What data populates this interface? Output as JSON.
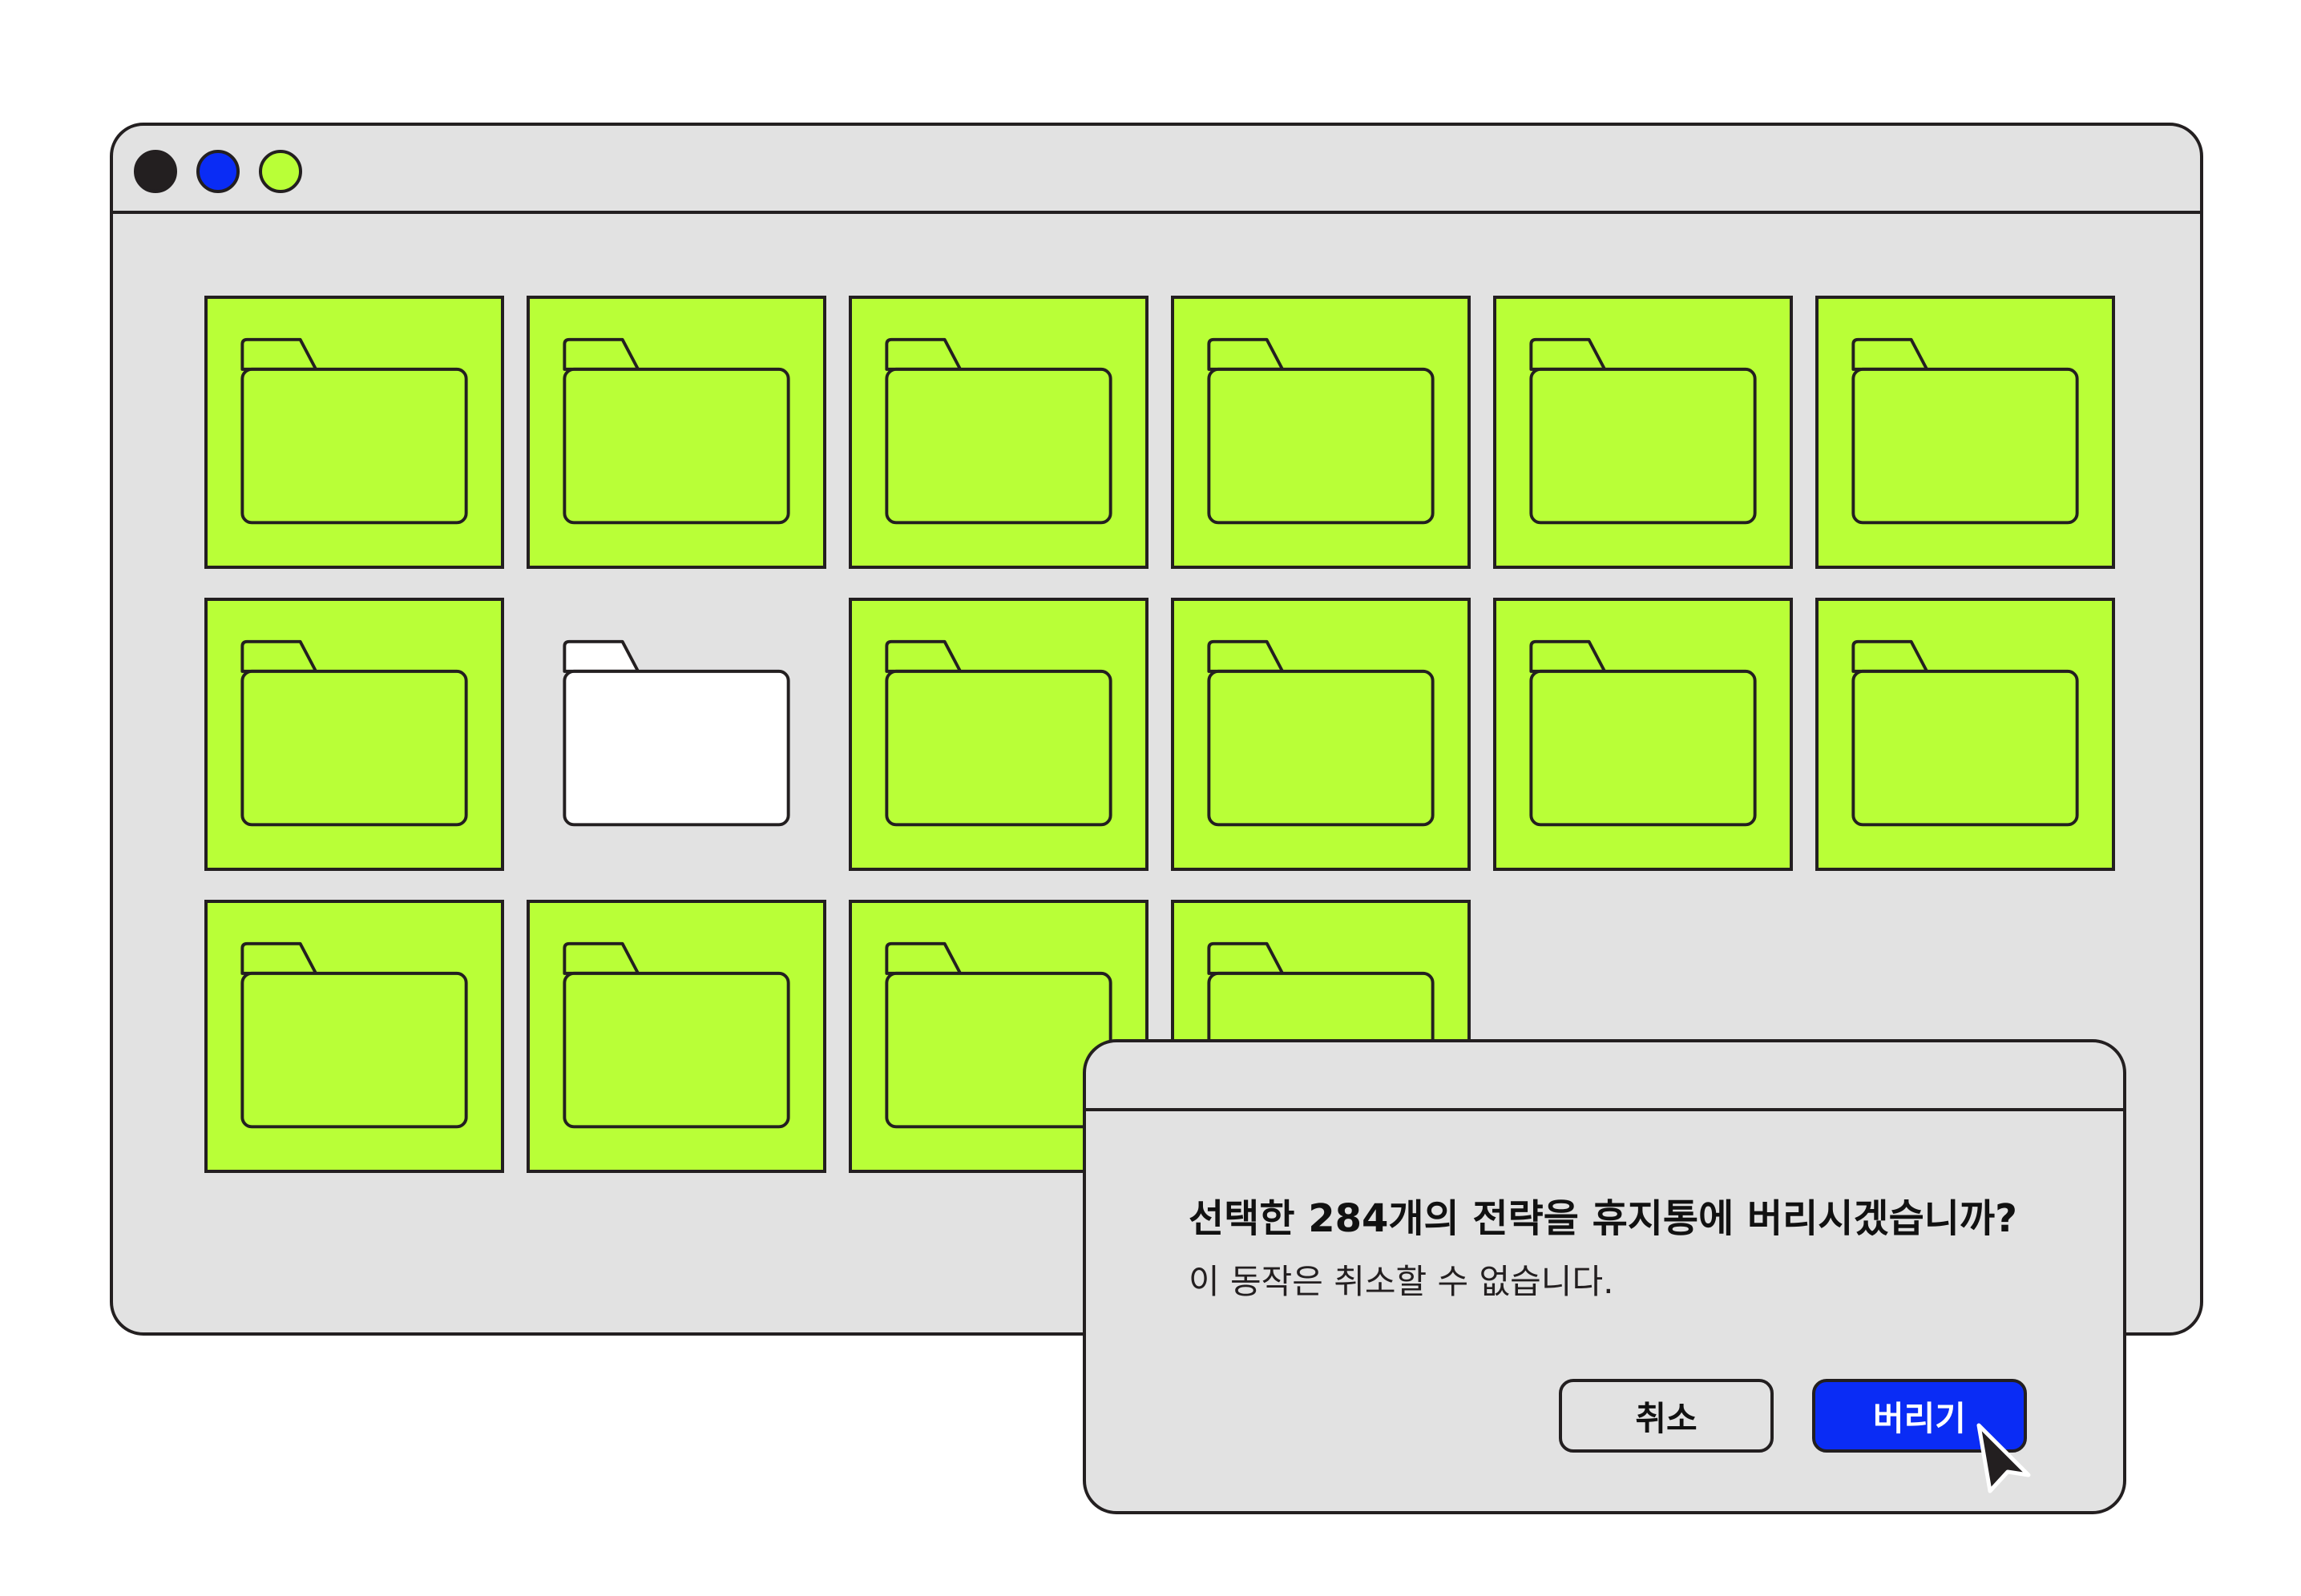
{
  "colors": {
    "window_bg": "#e2e2e2",
    "outline": "#231f20",
    "folder_green": "#b9ff37",
    "folder_white": "#ffffff",
    "dot_dark": "#231f20",
    "dot_blue": "#0a2cf5",
    "dot_green": "#b9ff37",
    "confirm_blue": "#0a2cf5"
  },
  "window": {
    "traffic_lights": [
      {
        "name": "close",
        "color": "#231f20"
      },
      {
        "name": "minimize",
        "color": "#0a2cf5"
      },
      {
        "name": "maximize",
        "color": "#b9ff37"
      }
    ],
    "folders": [
      {
        "state": "selected"
      },
      {
        "state": "selected"
      },
      {
        "state": "selected"
      },
      {
        "state": "selected"
      },
      {
        "state": "selected"
      },
      {
        "state": "selected"
      },
      {
        "state": "selected"
      },
      {
        "state": "unselected"
      },
      {
        "state": "selected"
      },
      {
        "state": "selected"
      },
      {
        "state": "selected"
      },
      {
        "state": "selected"
      },
      {
        "state": "selected"
      },
      {
        "state": "selected"
      },
      {
        "state": "selected"
      },
      {
        "state": "selected"
      }
    ]
  },
  "dialog": {
    "title": "선택한 284개의 전략을 휴지통에 버리시겠습니까?",
    "message": "이 동작은 취소할 수 없습니다.",
    "cancel_label": "취소",
    "confirm_label": "버리기"
  },
  "icons": {
    "folder": "folder-icon",
    "cursor": "mouse-pointer-icon"
  }
}
